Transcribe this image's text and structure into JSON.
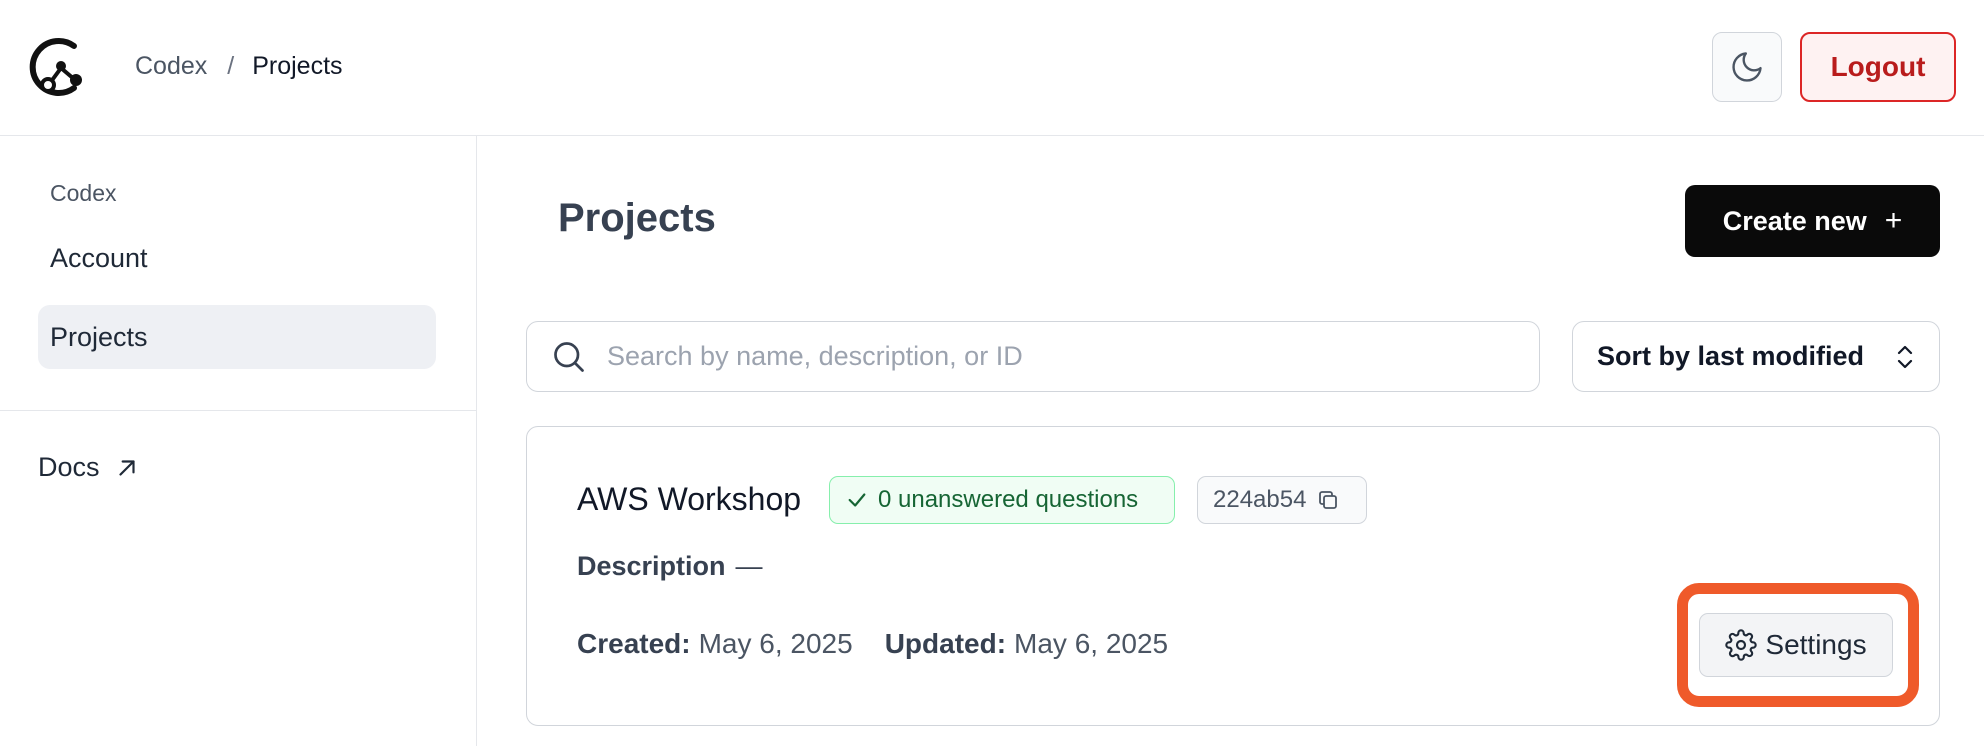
{
  "header": {
    "breadcrumb": {
      "root": "Codex",
      "separator": "/",
      "current": "Projects"
    },
    "logout_label": "Logout"
  },
  "sidebar": {
    "heading": "Codex",
    "items": [
      {
        "label": "Account",
        "active": false
      },
      {
        "label": "Projects",
        "active": true
      }
    ],
    "docs_label": "Docs"
  },
  "main": {
    "title": "Projects",
    "create_label": "Create new",
    "search": {
      "placeholder": "Search by name, description, or ID",
      "value": ""
    },
    "sort": {
      "label": "Sort by last modified"
    },
    "projects": [
      {
        "name": "AWS Workshop",
        "badge": "0 unanswered questions",
        "id": "224ab54",
        "description_label": "Description",
        "description_value": "—",
        "created_label": "Created:",
        "created_value": "May 6, 2025",
        "updated_label": "Updated:",
        "updated_value": "May 6, 2025",
        "settings_label": "Settings"
      }
    ]
  },
  "colors": {
    "accent_dark": "#0a0a0a",
    "logout_red": "#dc2626",
    "badge_green": "#166534",
    "highlight_orange": "#ef5a2a",
    "active_nav_bg": "#eef0f4"
  },
  "icons": [
    "codex-logo",
    "moon-icon",
    "external-link-icon",
    "plus-icon",
    "search-icon",
    "chevron-up-down-icon",
    "check-icon",
    "copy-icon",
    "gear-icon"
  ]
}
